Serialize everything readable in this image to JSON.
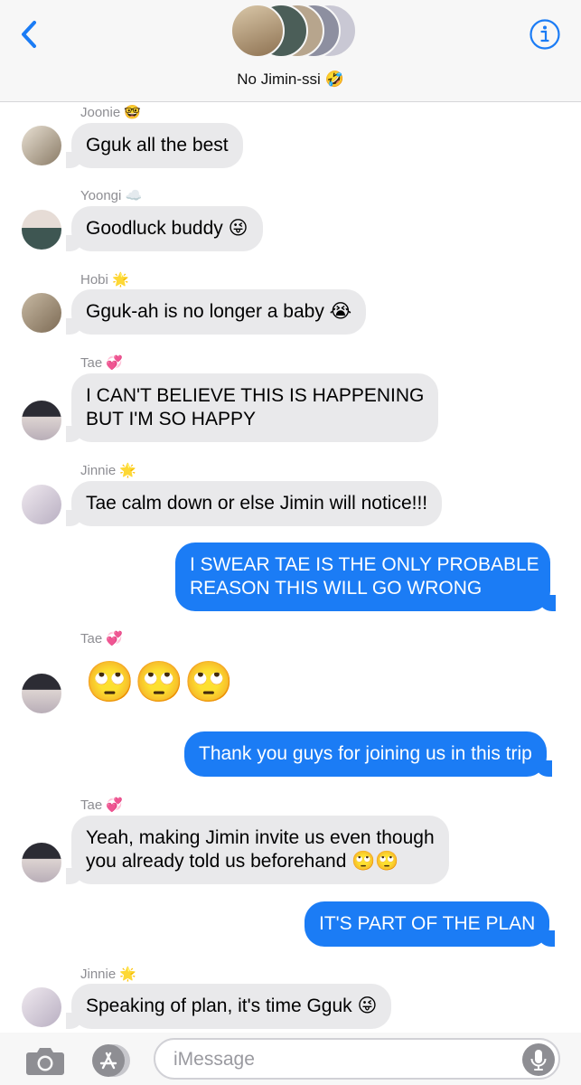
{
  "header": {
    "title": "No Jimin-ssi 🤣",
    "back_icon": "chevron-left-icon",
    "info_icon": "info-icon",
    "accent_color": "#1b7cf5"
  },
  "messages": [
    {
      "type": "in",
      "sender": "Joonie 🤓",
      "text": "Gguk all the best"
    },
    {
      "type": "in",
      "sender": "Yoongi ☁️",
      "text": "Goodluck buddy 😜"
    },
    {
      "type": "in",
      "sender": "Hobi 🌟",
      "text": "Gguk-ah is no longer a baby 😭"
    },
    {
      "type": "in",
      "sender": "Tae 💞",
      "lines": [
        "I CAN'T BELIEVE THIS IS HAPPENING",
        "BUT I'M SO HAPPY"
      ]
    },
    {
      "type": "in",
      "sender": "Jinnie 🌟",
      "text": "Tae calm down or else Jimin will notice!!!"
    },
    {
      "type": "out",
      "lines": [
        "I SWEAR TAE IS THE ONLY PROBABLE",
        "REASON THIS WILL GO WRONG"
      ]
    },
    {
      "type": "in",
      "sender": "Tae 💞",
      "text": "🙄🙄🙄"
    },
    {
      "type": "out",
      "text": "Thank you guys for joining us in this trip"
    },
    {
      "type": "in",
      "sender": "Tae 💞",
      "lines": [
        "Yeah, making Jimin invite us even though",
        "you already told us beforehand 🙄🙄"
      ]
    },
    {
      "type": "out",
      "text": "IT'S PART OF THE PLAN"
    },
    {
      "type": "in",
      "sender": "Jinnie 🌟",
      "text": "Speaking of plan, it's time Gguk 😜"
    }
  ],
  "composer": {
    "placeholder": "iMessage",
    "camera_icon": "camera-icon",
    "apps_icon": "app-store-icon",
    "mic_icon": "microphone-icon",
    "outgoing_color": "#1b7cf5",
    "incoming_color": "#e9e9eb"
  }
}
